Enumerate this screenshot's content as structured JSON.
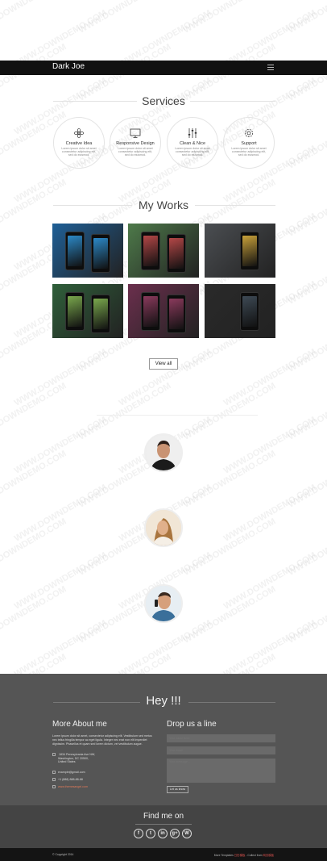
{
  "nav": {
    "brand": "Dark Joe",
    "menu_icon": "hamburger-icon"
  },
  "services": {
    "title": "Services",
    "items": [
      {
        "title": "Creative Idea",
        "desc": "Lorem ipsum dolor sit amet consectetur adipiscing elit, sed do eiusmod.",
        "icon": "flower-icon"
      },
      {
        "title": "Responsive Design",
        "desc": "Lorem ipsum dolor sit amet consectetur adipiscing elit, sed do eiusmod.",
        "icon": "monitor-icon"
      },
      {
        "title": "Clean & Nice",
        "desc": "Lorem ipsum dolor sit amet consectetur adipiscing elit, sed do eiusmod.",
        "icon": "sliders-icon"
      },
      {
        "title": "Support",
        "desc": "Lorem ipsum dolor sit amet consectetur adipiscing elit, sed do eiusmod.",
        "icon": "gear-icon"
      }
    ]
  },
  "works": {
    "title": "My Works",
    "view_all": "View all",
    "items": [
      {
        "bg": "#1f5f96",
        "phones": 2,
        "screen": "#2c89c7"
      },
      {
        "bg": "#4e7a4a",
        "phones": 2,
        "screen": "#b34747"
      },
      {
        "bg": "#4b4e52",
        "phones": 1,
        "screen": "#c8a13a"
      },
      {
        "bg": "#2f5f3a",
        "phones": 2,
        "screen": "#7aa84d"
      },
      {
        "bg": "#6b2f4d",
        "phones": 2,
        "screen": "#8a3a5c"
      },
      {
        "bg": "#2a2a2a",
        "phones": 1,
        "screen": "#3e4a55"
      }
    ]
  },
  "team": {
    "avatars": [
      "avatar-man-dark-shirt",
      "avatar-woman-smiling",
      "avatar-man-on-phone"
    ]
  },
  "footer": {
    "hey": "Hey !!!",
    "about_title": "More About me",
    "about_text": "Lorem ipsum dolor sit amet, consectetur adipiscing elit. Vestibulum sed metus nec tellus fringilla tempor ac eget ligula. Integer nec erat non elit imperdiet dignissim. Phasellus et quam sed lorem dictum, vel vestibulum augue.",
    "address": [
      "1834 Pennsylvania Ave NW,",
      "Washington, DC 20500,",
      "United States"
    ],
    "email": "example@gmail.com",
    "phone": "+1 (888) 888-88-88",
    "website": "www.themesangel.com",
    "drop_title": "Drop us a line",
    "name_placeholder": "Your name here",
    "email_placeholder": "Your email",
    "message_placeholder": "Your message...",
    "send_label": "Let us know"
  },
  "findme": {
    "title": "Find me on",
    "socials": [
      {
        "glyph": "f",
        "icon": "facebook-icon"
      },
      {
        "glyph": "t",
        "icon": "twitter-icon"
      },
      {
        "glyph": "in",
        "icon": "linkedin-icon"
      },
      {
        "glyph": "g+",
        "icon": "googleplus-icon"
      },
      {
        "glyph": "W",
        "icon": "wordpress-icon"
      }
    ]
  },
  "bottom": {
    "copyright": "© Copyright 2014",
    "credit_prefix": "More Templates",
    "credit_link1": "日历模板",
    "credit_mid": " - Collect from",
    "credit_link2": "网页模板"
  },
  "watermark": "WWW.DOWNDEMO.COM"
}
